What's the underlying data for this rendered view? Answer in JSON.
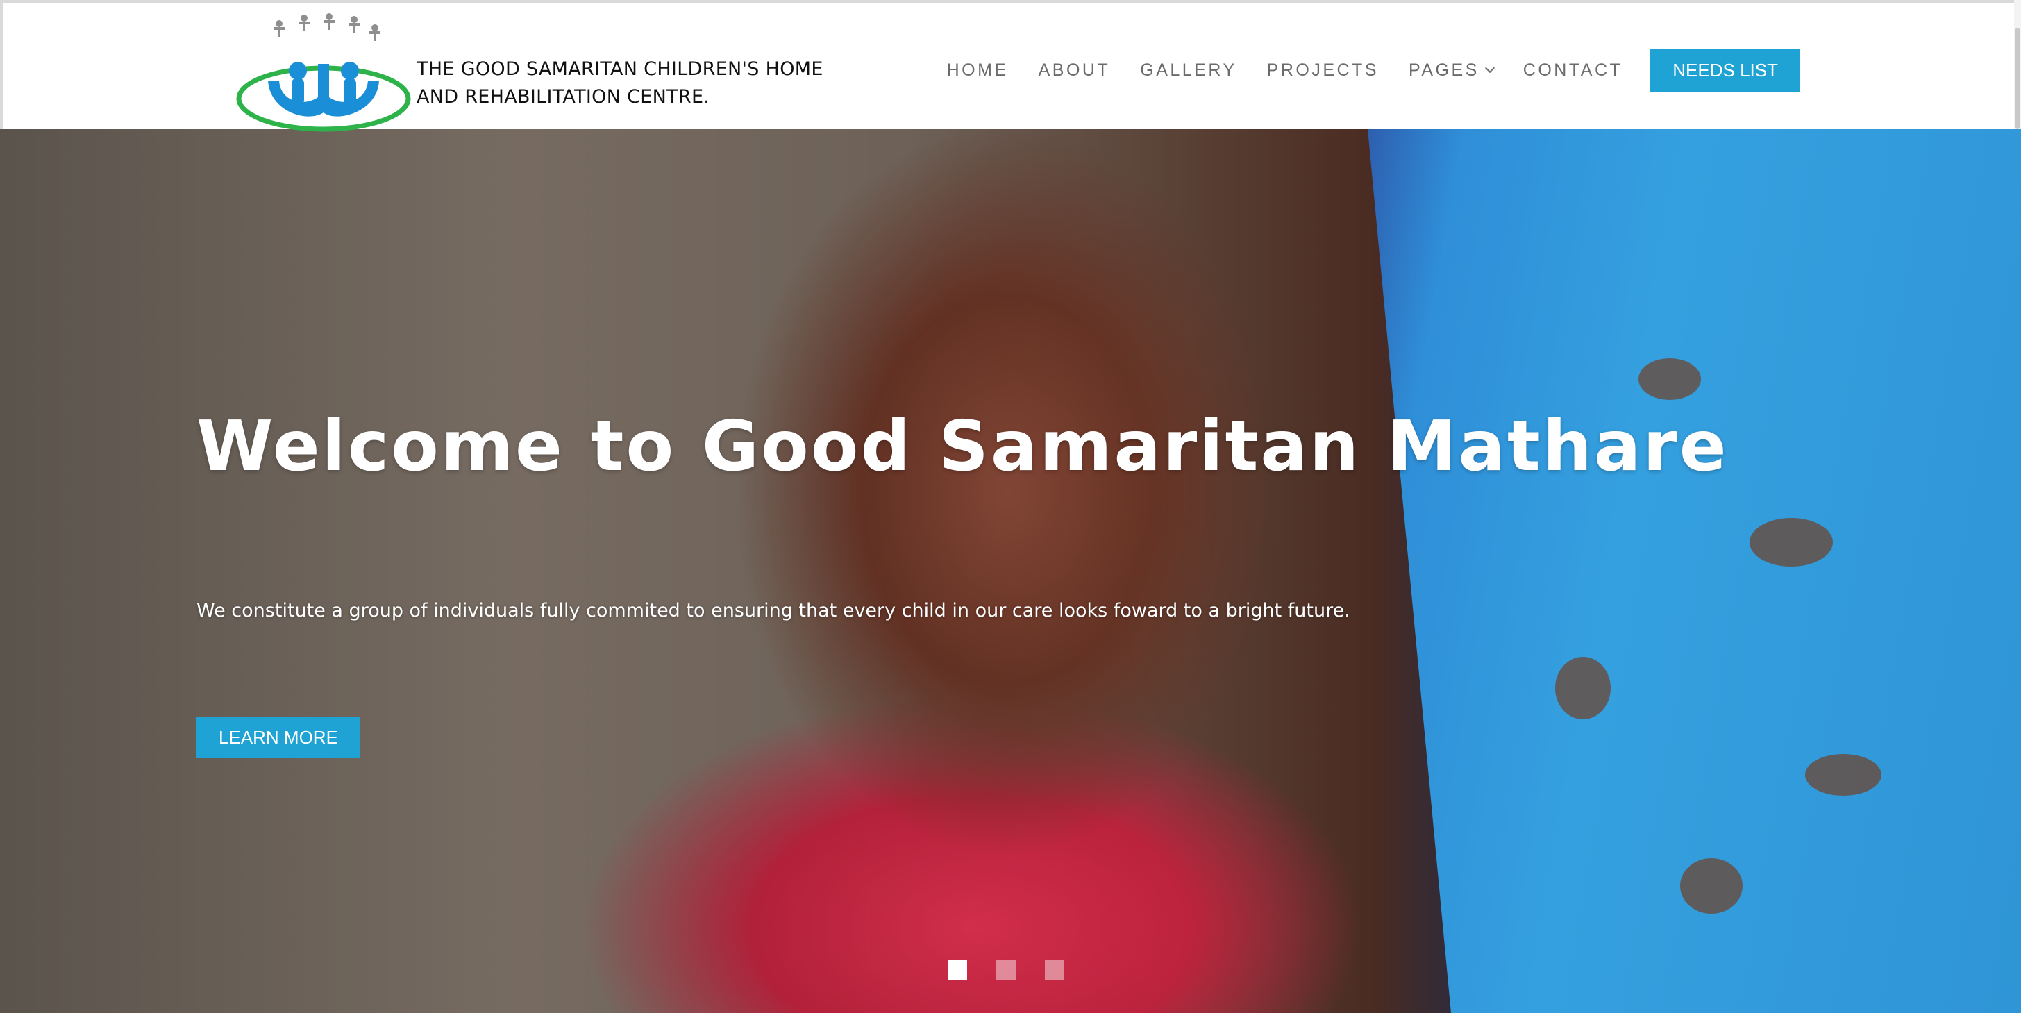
{
  "brand": {
    "name_line1": "THE GOOD SAMARITAN CHILDREN'S HOME",
    "name_line2": "AND REHABILITATION CENTRE."
  },
  "nav": {
    "items": [
      {
        "label": "HOME"
      },
      {
        "label": "ABOUT"
      },
      {
        "label": "GALLERY"
      },
      {
        "label": "PROJECTS"
      },
      {
        "label": "PAGES"
      },
      {
        "label": "CONTACT"
      }
    ],
    "cta_label": "NEEDS LIST"
  },
  "hero": {
    "title": "Welcome to Good Samaritan Mathare",
    "subtitle": "We constitute a group of individuals fully commited to ensuring that every child in our care looks foward to a bright future.",
    "button_label": "LEARN MORE",
    "slide_count": 3,
    "active_slide": 1
  },
  "colors": {
    "accent": "#1ea3d4",
    "logo_blue": "#1a8fd8",
    "logo_green": "#2db34a",
    "nav_text": "#6b6b6b"
  },
  "icons": {
    "logo": "children-holding-hands-logo",
    "dropdown": "chevron-down-icon"
  }
}
